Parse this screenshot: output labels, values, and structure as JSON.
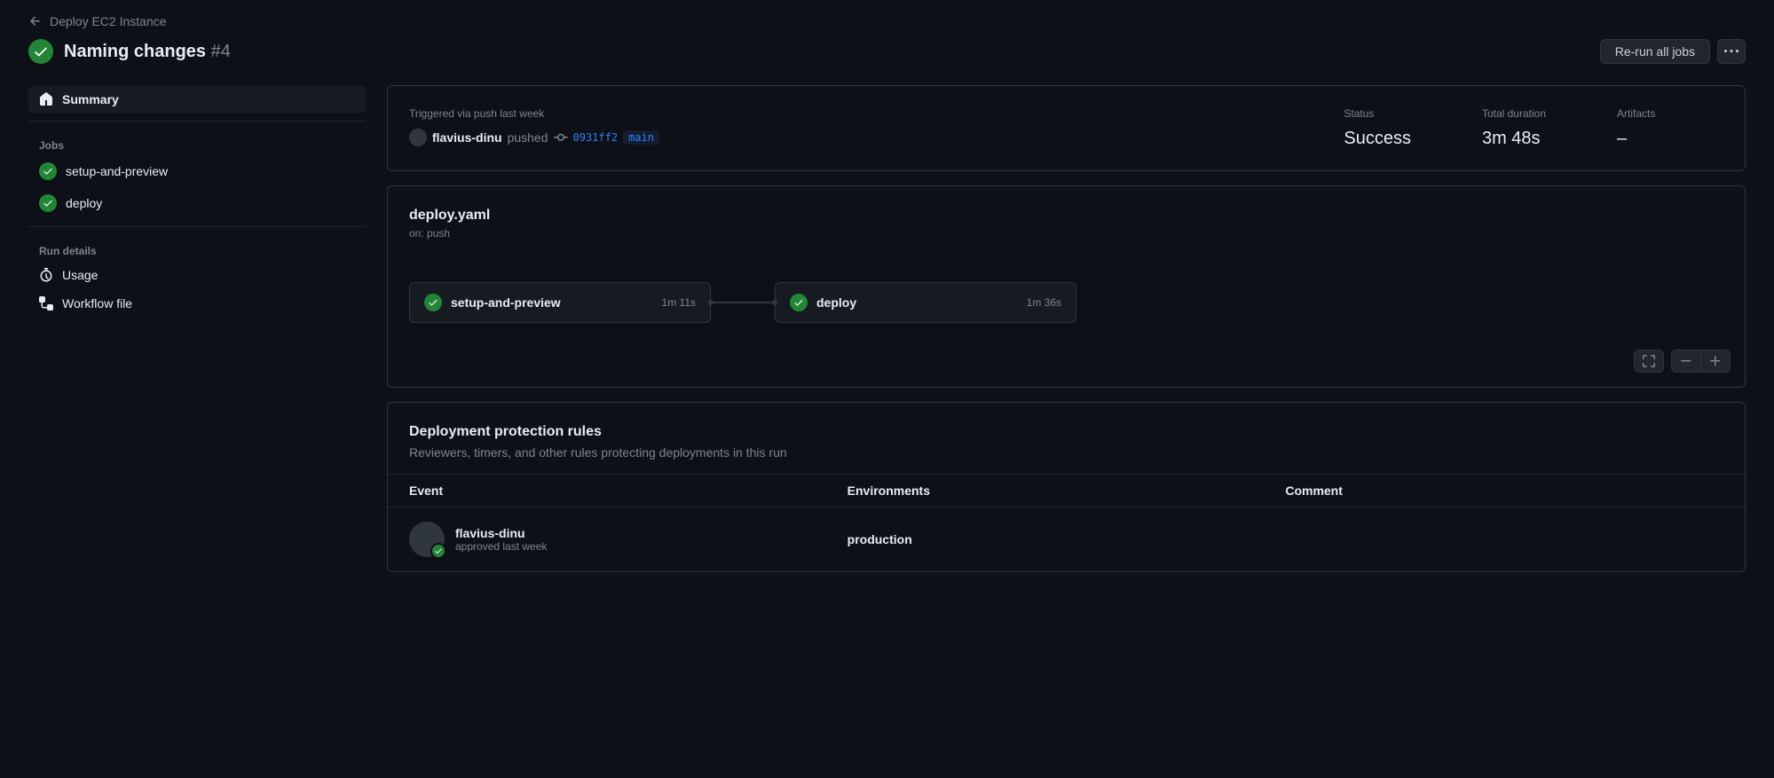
{
  "breadcrumb": {
    "parent": "Deploy EC2 Instance"
  },
  "title": {
    "name": "Naming changes",
    "run_number": "#4"
  },
  "actions": {
    "rerun": "Re-run all jobs"
  },
  "sidebar": {
    "summary": "Summary",
    "jobs_header": "Jobs",
    "jobs": [
      {
        "label": "setup-and-preview"
      },
      {
        "label": "deploy"
      }
    ],
    "run_details_header": "Run details",
    "usage": "Usage",
    "workflow_file": "Workflow file"
  },
  "summary": {
    "triggered_label": "Triggered via push last week",
    "actor": "flavius-dinu",
    "action_verb": "pushed",
    "sha": "0931ff2",
    "branch": "main",
    "status_label": "Status",
    "status_value": "Success",
    "duration_label": "Total duration",
    "duration_value": "3m 48s",
    "artifacts_label": "Artifacts",
    "artifacts_value": "–"
  },
  "workflow": {
    "file": "deploy.yaml",
    "on": "on: push",
    "jobs": [
      {
        "name": "setup-and-preview",
        "duration": "1m 11s"
      },
      {
        "name": "deploy",
        "duration": "1m 36s"
      }
    ]
  },
  "protection": {
    "title": "Deployment protection rules",
    "subtitle": "Reviewers, timers, and other rules protecting deployments in this run",
    "columns": {
      "event": "Event",
      "env": "Environments",
      "comment": "Comment"
    },
    "rows": [
      {
        "actor": "flavius-dinu",
        "desc": "approved last week",
        "environment": "production",
        "comment": ""
      }
    ]
  }
}
